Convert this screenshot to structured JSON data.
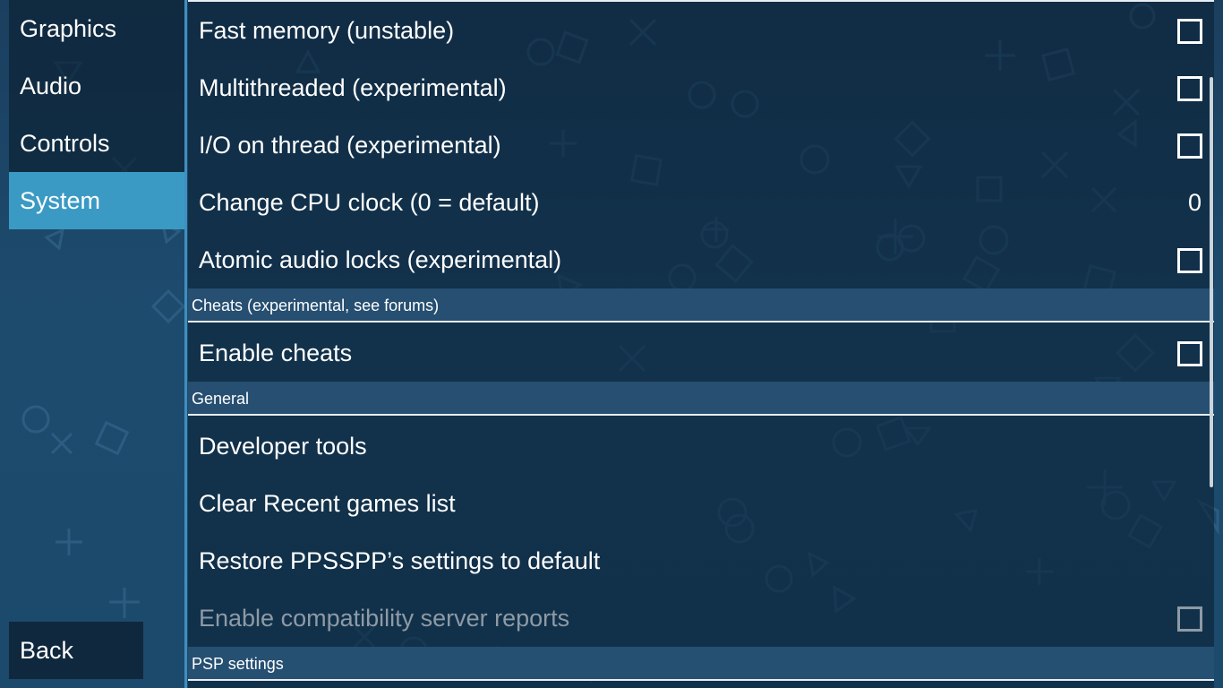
{
  "tabs": [
    {
      "label": "Graphics",
      "active": false
    },
    {
      "label": "Audio",
      "active": false
    },
    {
      "label": "Controls",
      "active": false
    },
    {
      "label": "System",
      "active": true
    }
  ],
  "back_label": "Back",
  "rows": [
    {
      "label": "Fast memory (unstable)",
      "control": "checkbox",
      "checked": false
    },
    {
      "label": "Multithreaded (experimental)",
      "control": "checkbox",
      "checked": false
    },
    {
      "label": "I/O on thread (experimental)",
      "control": "checkbox",
      "checked": false
    },
    {
      "label": "Change CPU clock (0 = default)",
      "control": "value",
      "value": "0"
    },
    {
      "label": "Atomic audio locks (experimental)",
      "control": "checkbox",
      "checked": false
    }
  ],
  "sections": [
    {
      "title": "Cheats (experimental, see forums)",
      "rows": [
        {
          "label": "Enable cheats",
          "control": "checkbox",
          "checked": false
        }
      ]
    },
    {
      "title": "General",
      "rows": [
        {
          "label": "Developer tools",
          "control": "none"
        },
        {
          "label": "Clear Recent games list",
          "control": "none"
        },
        {
          "label": "Restore PPSSPP’s settings to default",
          "control": "none"
        },
        {
          "label": "Enable compatibility server reports",
          "control": "checkbox",
          "checked": false,
          "disabled": true
        }
      ]
    },
    {
      "title": "PSP settings",
      "rows": []
    }
  ],
  "background_symbols": [
    "circle",
    "cross",
    "square",
    "triangle"
  ],
  "colors": {
    "background": "#1d4669",
    "panel": "#0c2236",
    "tab_active": "#3a9ac4",
    "section_header": "#285275",
    "divider": "#3f8fbf",
    "disabled_text": "#8e9aa5"
  }
}
